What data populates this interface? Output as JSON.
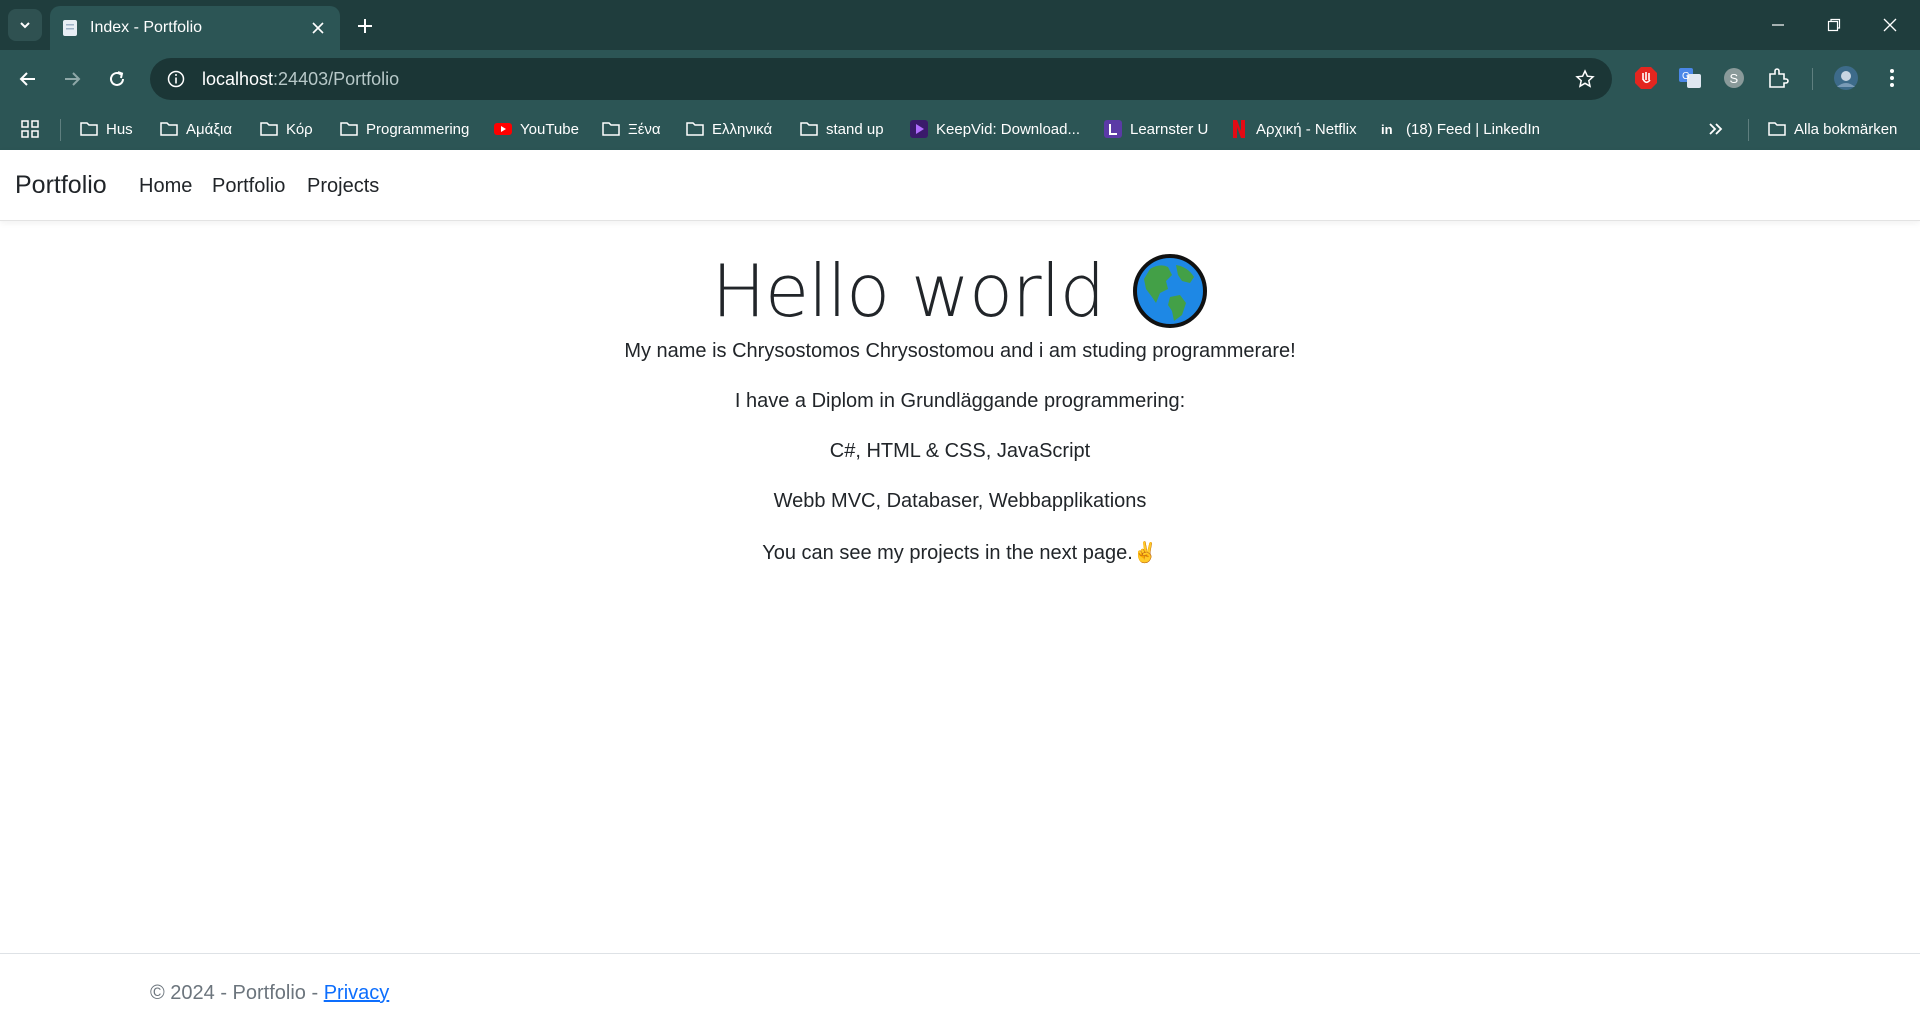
{
  "browser": {
    "tab_title": "Index - Portfolio",
    "url_host": "localhost",
    "url_rest": ":24403/Portfolio",
    "bookmarks": [
      {
        "label": "Hus",
        "icon": "folder-icon"
      },
      {
        "label": "Αμάξια",
        "icon": "folder-icon"
      },
      {
        "label": "Κόρ",
        "icon": "folder-icon"
      },
      {
        "label": "Programmering",
        "icon": "folder-icon"
      },
      {
        "label": "YouTube",
        "icon": "youtube-icon"
      },
      {
        "label": "Ξένα",
        "icon": "folder-icon"
      },
      {
        "label": "Ελληνικά",
        "icon": "folder-icon"
      },
      {
        "label": "stand up",
        "icon": "folder-icon"
      },
      {
        "label": "KeepVid: Download...",
        "icon": "keepvid-icon"
      },
      {
        "label": "Learnster U",
        "icon": "learnster-icon"
      },
      {
        "label": "Αρχική - Netflix",
        "icon": "netflix-icon"
      },
      {
        "label": "(18) Feed | LinkedIn",
        "icon": "linkedin-icon"
      }
    ],
    "all_bookmarks": "Alla bokmärken"
  },
  "navbar": {
    "brand": "Portfolio",
    "links": [
      "Home",
      "Portfolio",
      "Projects"
    ]
  },
  "main": {
    "heading": "Hello world",
    "lines": [
      "My name is Chrysostomos Chrysostomou and i am studing programmerare!",
      "I have a Diplom in Grundläggande programmering:",
      "C#, HTML & CSS, JavaScript",
      "Webb MVC, Databaser, Webbapplikations",
      "You can see my projects in the next page.✌️"
    ]
  },
  "footer": {
    "text": "© 2024 - Portfolio - ",
    "link": "Privacy"
  },
  "colors": {
    "chrome_dark": "#1f3d3d",
    "chrome": "#2c5555",
    "link": "#0d6efd"
  }
}
